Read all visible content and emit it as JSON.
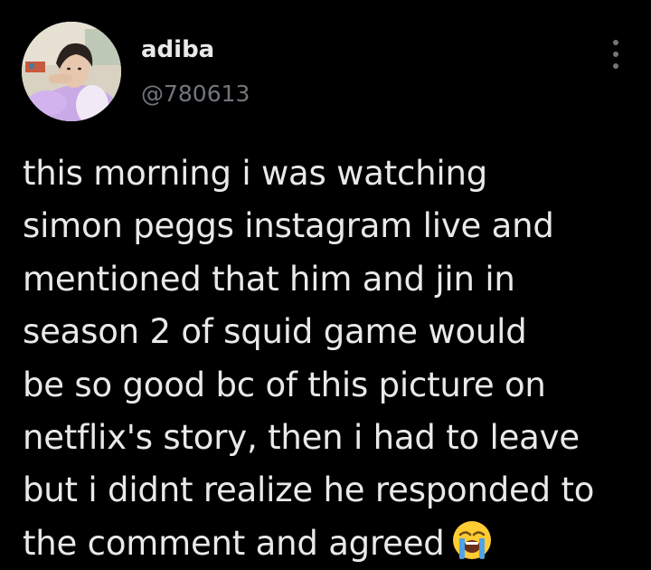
{
  "user": {
    "display_name": "adiba",
    "handle": "@780613",
    "avatar_icon": "profile-photo"
  },
  "actions": {
    "more_icon": "more-vertical-icon"
  },
  "tweet": {
    "lines": [
      "this morning i was watching",
      "simon peggs instagram live and",
      "mentioned that him and jin in",
      "season 2 of squid game would",
      "be so good bc of this picture on",
      "netflix's story, then i had to leave",
      "but i didnt realize he responded to",
      "the comment and agreed"
    ],
    "emoji": "loudly-crying-face-emoji"
  },
  "colors": {
    "background": "#000000",
    "text_primary": "#e7e9ea",
    "text_secondary": "#71767b"
  }
}
